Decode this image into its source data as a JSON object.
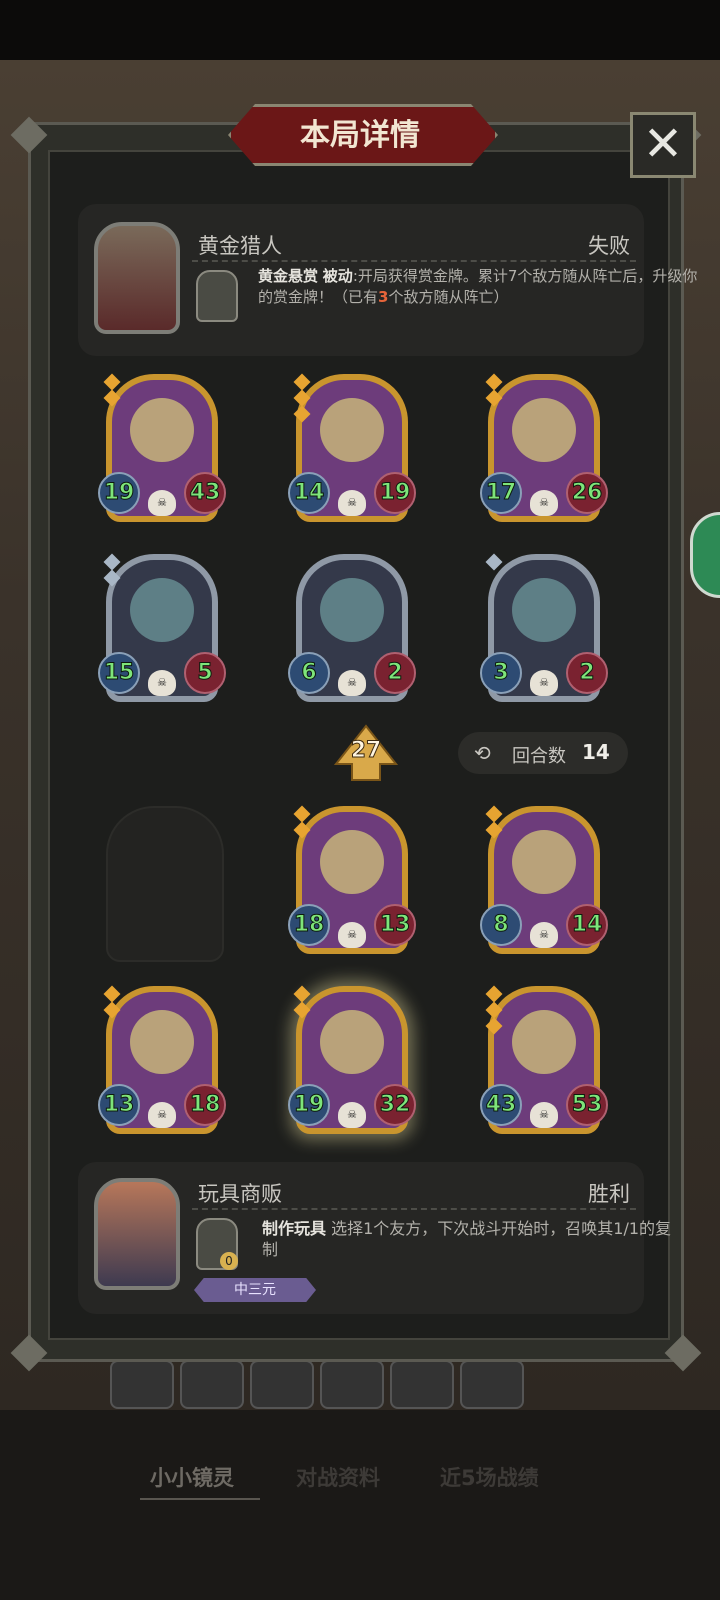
{
  "title": "本局详情",
  "close_icon": "✕",
  "opponent": {
    "name": "黄金猎人",
    "result": "失败",
    "skill_name": "黄金悬赏",
    "skill_type": "被动",
    "skill_desc_a": ":开局获得赏金牌。累计7个敌方随从阵亡后，升级你的赏金牌！（已有",
    "skill_count": "3",
    "skill_desc_b": "个敌方随从阵亡）"
  },
  "opponent_board": [
    {
      "attack": "19",
      "health": "43",
      "tier": 2
    },
    {
      "attack": "14",
      "health": "19",
      "tier": 3
    },
    {
      "attack": "17",
      "health": "26",
      "tier": 2
    },
    {
      "attack": "15",
      "health": "5",
      "tier": 2
    },
    {
      "attack": "6",
      "health": "2",
      "tier": 0
    },
    {
      "attack": "3",
      "health": "2",
      "tier": 1
    }
  ],
  "level_badge": "27",
  "rounds": {
    "label": "回合数",
    "value": "14"
  },
  "player_board": [
    {
      "attack": "18",
      "health": "13",
      "tier": 2
    },
    {
      "attack": "8",
      "health": "14",
      "tier": 2
    },
    {
      "attack": "13",
      "health": "18",
      "tier": 2
    },
    {
      "attack": "19",
      "health": "32",
      "tier": 2
    },
    {
      "attack": "43",
      "health": "53",
      "tier": 3
    }
  ],
  "player": {
    "name": "玩具商贩",
    "result": "胜利",
    "skill_name": "制作玩具",
    "skill_desc": " 选择1个友方，下次战斗开始时，召唤其1/1的复制",
    "skill_cost": "0",
    "tag": "中三元"
  },
  "bottom_tabs": [
    "小小镜灵",
    "对战资料",
    "近5场战绩"
  ],
  "colors": {
    "gold_frame": "#c9952e",
    "silver_frame": "#8f99a6",
    "title_banner": "#6b1717",
    "win_tag": "#6a5c91"
  }
}
